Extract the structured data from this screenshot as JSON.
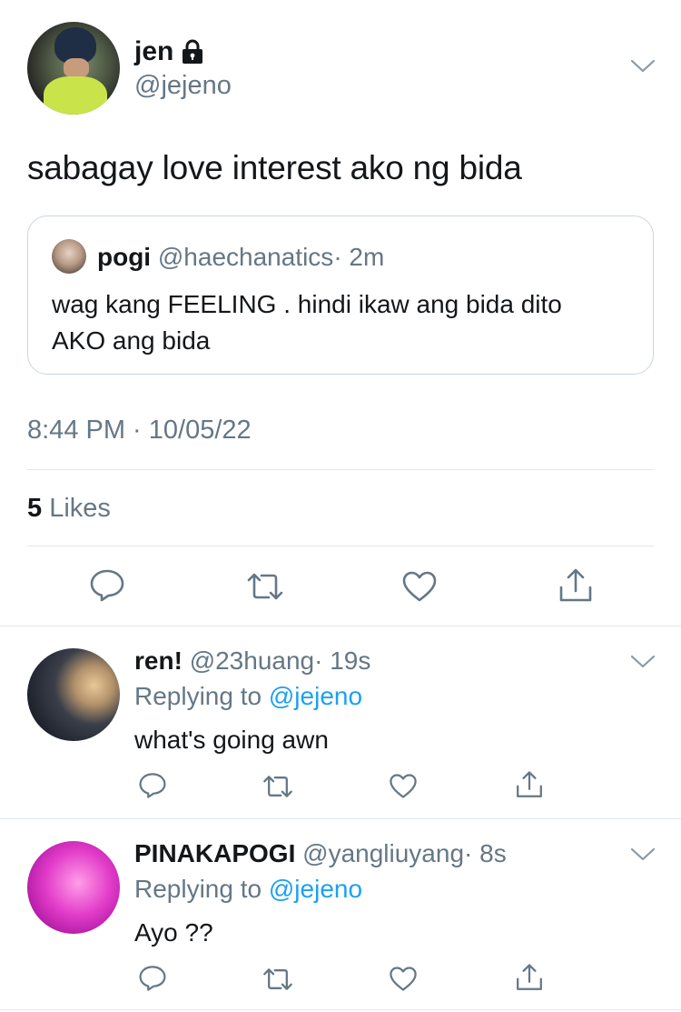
{
  "main_tweet": {
    "display_name": "jen",
    "handle": "@jejeno",
    "text": "sabagay love interest ako ng bida",
    "timestamp": "8:44 PM · 10/05/22",
    "likes_count": "5",
    "likes_label": "Likes",
    "quoted": {
      "display_name": "pogi",
      "handle": "@haechanatics",
      "time": "· 2m",
      "text_line1": "wag kang FEELING . hindi ikaw ang bida dito",
      "text_line2": "AKO ang bida"
    }
  },
  "replies": [
    {
      "display_name": "ren!",
      "handle": "@23huang",
      "time": "· 19s",
      "replying_prefix": "Replying to",
      "replying_to": "@jejeno",
      "text": "what's going awn"
    },
    {
      "display_name": "PINAKAPOGI",
      "handle": "@yangliuyang",
      "time": "· 8s",
      "replying_prefix": "Replying to",
      "replying_to": "@jejeno",
      "text": "Ayo ??"
    }
  ],
  "icons": {
    "lock": "lock-icon",
    "chevron": "chevron-down-icon",
    "reply": "reply-icon",
    "retweet": "retweet-icon",
    "like": "heart-icon",
    "share": "share-icon"
  },
  "colors": {
    "text": "#14171a",
    "secondary": "#657786",
    "link": "#1da1f2",
    "border": "#e1e8ed"
  }
}
